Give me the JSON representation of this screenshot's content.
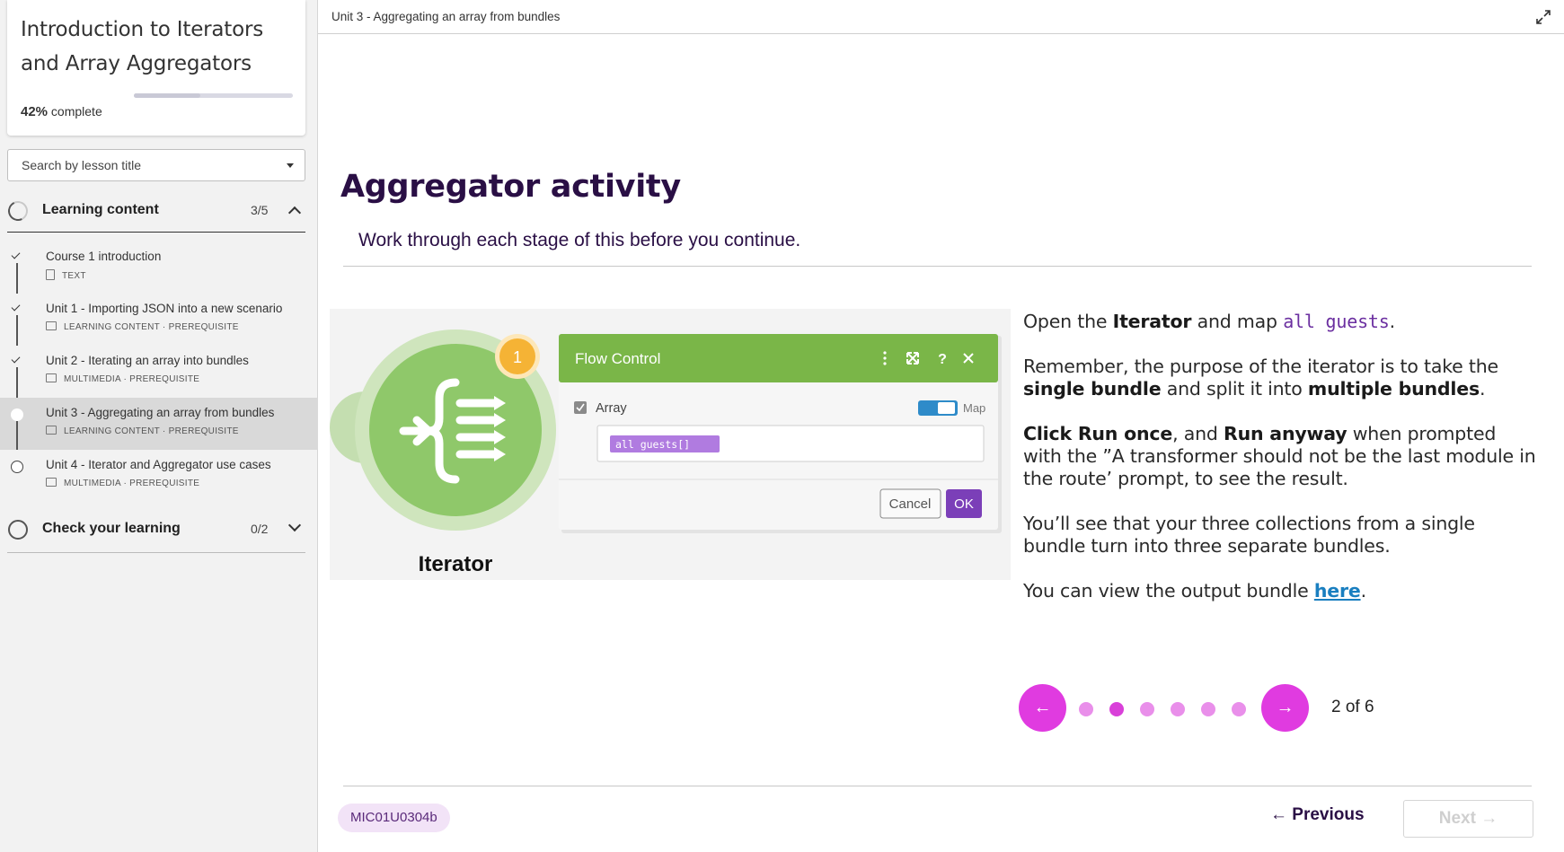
{
  "sidebar": {
    "course_title": "Introduction to Iterators and Array Aggregators",
    "progress_percent": 42,
    "progress_value": "42%",
    "progress_label": "complete",
    "search_placeholder": "Search by lesson title",
    "sections": [
      {
        "label": "Learning content",
        "count": "3/5",
        "expanded": true
      },
      {
        "label": "Check your learning",
        "count": "0/2",
        "expanded": false
      }
    ],
    "lessons": [
      {
        "title": "Course 1 introduction",
        "meta": "TEXT",
        "status": "done",
        "icon": "document-icon"
      },
      {
        "title": "Unit 1 - Importing JSON into a new scenario",
        "meta": "LEARNING CONTENT · PREREQUISITE",
        "status": "done",
        "icon": "media-icon"
      },
      {
        "title": "Unit 2 - Iterating an array into bundles",
        "meta": "MULTIMEDIA · PREREQUISITE",
        "status": "done",
        "icon": "media-icon"
      },
      {
        "title": "Unit 3 - Aggregating an array from bundles",
        "meta": "LEARNING CONTENT · PREREQUISITE",
        "status": "current",
        "icon": "media-icon"
      },
      {
        "title": "Unit 4 - Iterator and Aggregator use cases",
        "meta": "MULTIMEDIA · PREREQUISITE",
        "status": "todo",
        "icon": "media-icon"
      }
    ]
  },
  "main": {
    "breadcrumb": "Unit 3 - Aggregating an array from bundles",
    "heading": "Aggregator activity",
    "subheading": "Work through each stage of this before you continue.",
    "figure": {
      "module_label": "Iterator",
      "badge": "1",
      "dialog_title": "Flow Control",
      "field_label": "Array",
      "toggle_label": "Map",
      "field_value": "all guests[]",
      "cancel_label": "Cancel",
      "ok_label": "OK"
    },
    "text": {
      "p1_a": "Open the ",
      "p1_b": "Iterator",
      "p1_c": " and map ",
      "p1_code": "all guests",
      "p1_d": ".",
      "p2_a": "Remember, the purpose of the iterator is to take the ",
      "p2_b": "single bundle",
      "p2_c": " and split it into ",
      "p2_d": "multiple bundles",
      "p2_e": ".",
      "p3_a": "Click Run once",
      "p3_b": ", and ",
      "p3_c": "Run anyway",
      "p3_d": " when prompted with the ”A transformer should not be the last module in the route’ prompt, to see the result.",
      "p4": "You’ll see that your three collections from a single bundle turn into three separate bundles.",
      "p5_a": "You can view the output bundle ",
      "p5_link": "here",
      "p5_b": "."
    },
    "pager": {
      "current": 2,
      "total": 6,
      "label": "2 of 6",
      "prev_glyph": "←",
      "next_glyph": "→"
    },
    "footer": {
      "tag": "MIC01U0304b",
      "previous_label": "← Previous",
      "next_label": "Next →"
    }
  },
  "colors": {
    "accent": "#e03be0",
    "dot": "#e98fea",
    "heading": "#2a0f45",
    "flow_control_green": "#7ab648",
    "ok_purple": "#7b3fb8"
  }
}
